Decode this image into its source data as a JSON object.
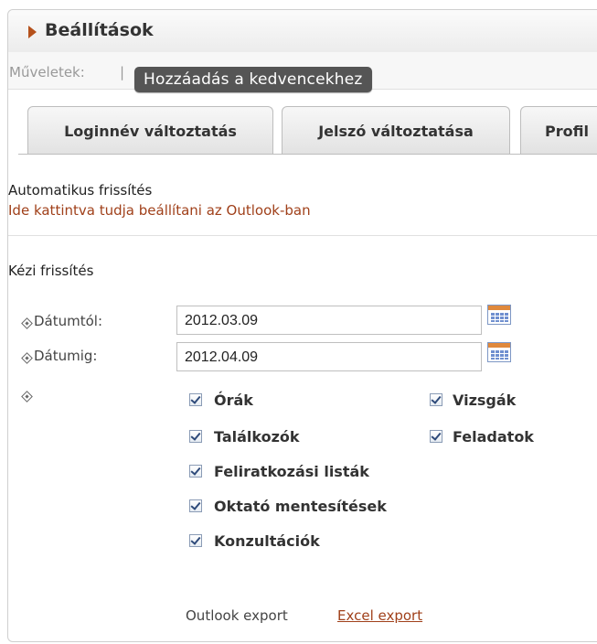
{
  "header": {
    "title": "Beállítások"
  },
  "actions": {
    "label": "Műveletek:",
    "separator": "|",
    "favorite_button": "Hozzáadás a kedvencekhez"
  },
  "tabs": [
    {
      "label": "Loginnév változtatás"
    },
    {
      "label": "Jelszó változtatása"
    },
    {
      "label": "Profil"
    }
  ],
  "auto_refresh": {
    "title": "Automatikus frissítés",
    "link": "Ide kattintva tudja beállítani az Outlook-ban"
  },
  "manual_refresh": {
    "title": "Kézi frissítés",
    "date_from": {
      "label": "Dátumtól:",
      "value": "2012.03.09"
    },
    "date_to": {
      "label": "Dátumig:",
      "value": "2012.04.09"
    }
  },
  "checkboxes": [
    {
      "label": "Órák",
      "checked": true
    },
    {
      "label": "Vizsgák",
      "checked": true
    },
    {
      "label": "Találkozók",
      "checked": true
    },
    {
      "label": "Feladatok",
      "checked": true
    },
    {
      "label": "Feliratkozási listák",
      "checked": true
    },
    {
      "label": "Oktató mentesítések",
      "checked": true
    },
    {
      "label": "Konzultációk",
      "checked": true
    }
  ],
  "exports": {
    "outlook": "Outlook export",
    "excel": "Excel export"
  },
  "colors": {
    "accent": "#a0401a",
    "title_arrow": "#b5511c",
    "button_bg": "#555555"
  }
}
